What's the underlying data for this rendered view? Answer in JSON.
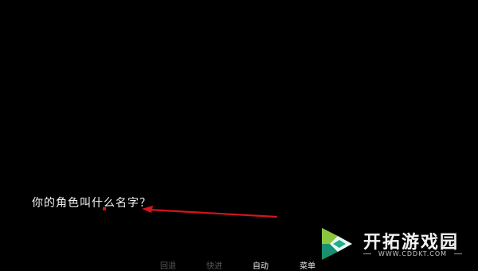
{
  "dialogue": {
    "text": "你的角色叫什么名字？"
  },
  "menu": {
    "back": "回退",
    "skip": "快进",
    "auto": "自动",
    "main": "菜单"
  },
  "watermark": {
    "title": "开拓游戏园",
    "url": "WWW.CDDKT.COM",
    "logo_icon": "play-triangle-logo-icon",
    "logo_colors": [
      "#1fae8e",
      "#8cc63f",
      "#ffffff"
    ]
  },
  "annotation": {
    "icon": "red-arrow-icon",
    "color": "#d4141c"
  },
  "colors": {
    "background": "#000000",
    "dialogue_text": "#f2f2f2",
    "menu_active": "#e6e6e6",
    "menu_inactive": "#5a5a5a"
  }
}
